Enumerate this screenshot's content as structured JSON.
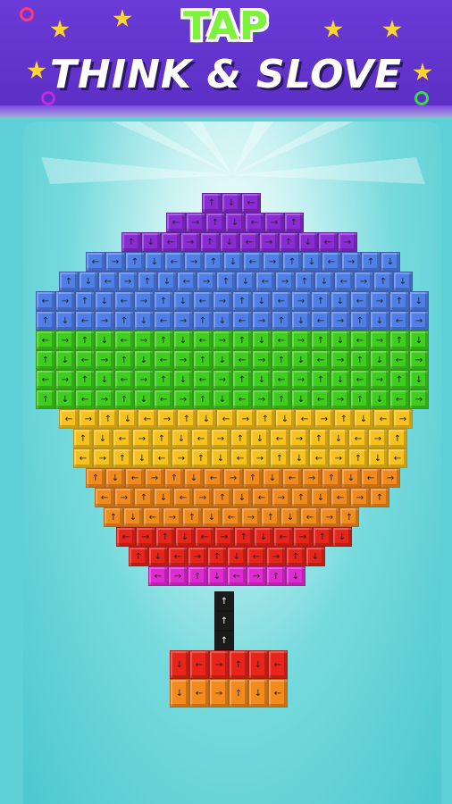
{
  "banner": {
    "line1": "TAP",
    "line2": "THINK & SLOVE",
    "colors": {
      "background": "#5a2fc4",
      "tap": "#7df23a",
      "star": "#ffd52e"
    }
  },
  "puzzle": {
    "name_icon": "arrow-block-balloon",
    "palette": {
      "purple": "#8a2bd6",
      "blue": "#4f7fe8",
      "green": "#3ecf1c",
      "yellow": "#f7c21b",
      "orange": "#f38a1c",
      "red": "#e8241b",
      "magenta": "#e22ad2",
      "black": "#1b1b1b"
    },
    "arrow_glyphs": [
      "↑",
      "↓",
      "←",
      "→"
    ]
  }
}
